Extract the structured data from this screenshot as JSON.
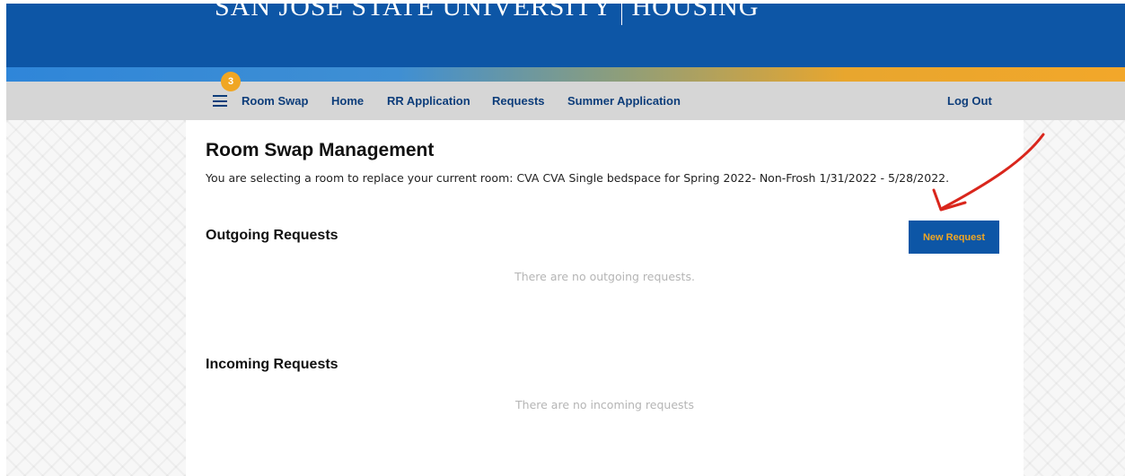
{
  "header": {
    "brand_left": "SAN JOSE STATE UNIVERSITY",
    "brand_right": "HOUSING"
  },
  "nav": {
    "badge_count": "3",
    "links": [
      {
        "label": "Room Swap"
      },
      {
        "label": "Home"
      },
      {
        "label": "RR Application"
      },
      {
        "label": "Requests"
      },
      {
        "label": "Summer Application"
      }
    ],
    "logout_label": "Log Out"
  },
  "main": {
    "title": "Room Swap Management",
    "intro_text": "You are selecting a room to replace your current room: CVA CVA Single bedspace for Spring 2022- Non-Frosh 1/31/2022 - 5/28/2022.",
    "outgoing": {
      "title": "Outgoing Requests",
      "empty_message": "There are no outgoing requests."
    },
    "new_request_label": "New Request",
    "incoming": {
      "title": "Incoming Requests",
      "empty_message": "There are no incoming requests"
    }
  },
  "colors": {
    "brand_blue": "#0d56a6",
    "accent_gold": "#f0a623",
    "nav_gray": "#d6d6d6",
    "annotation_red": "#d9261c"
  },
  "icons": {
    "menu": "hamburger-menu-icon",
    "annotation": "red-arrow-annotation"
  }
}
